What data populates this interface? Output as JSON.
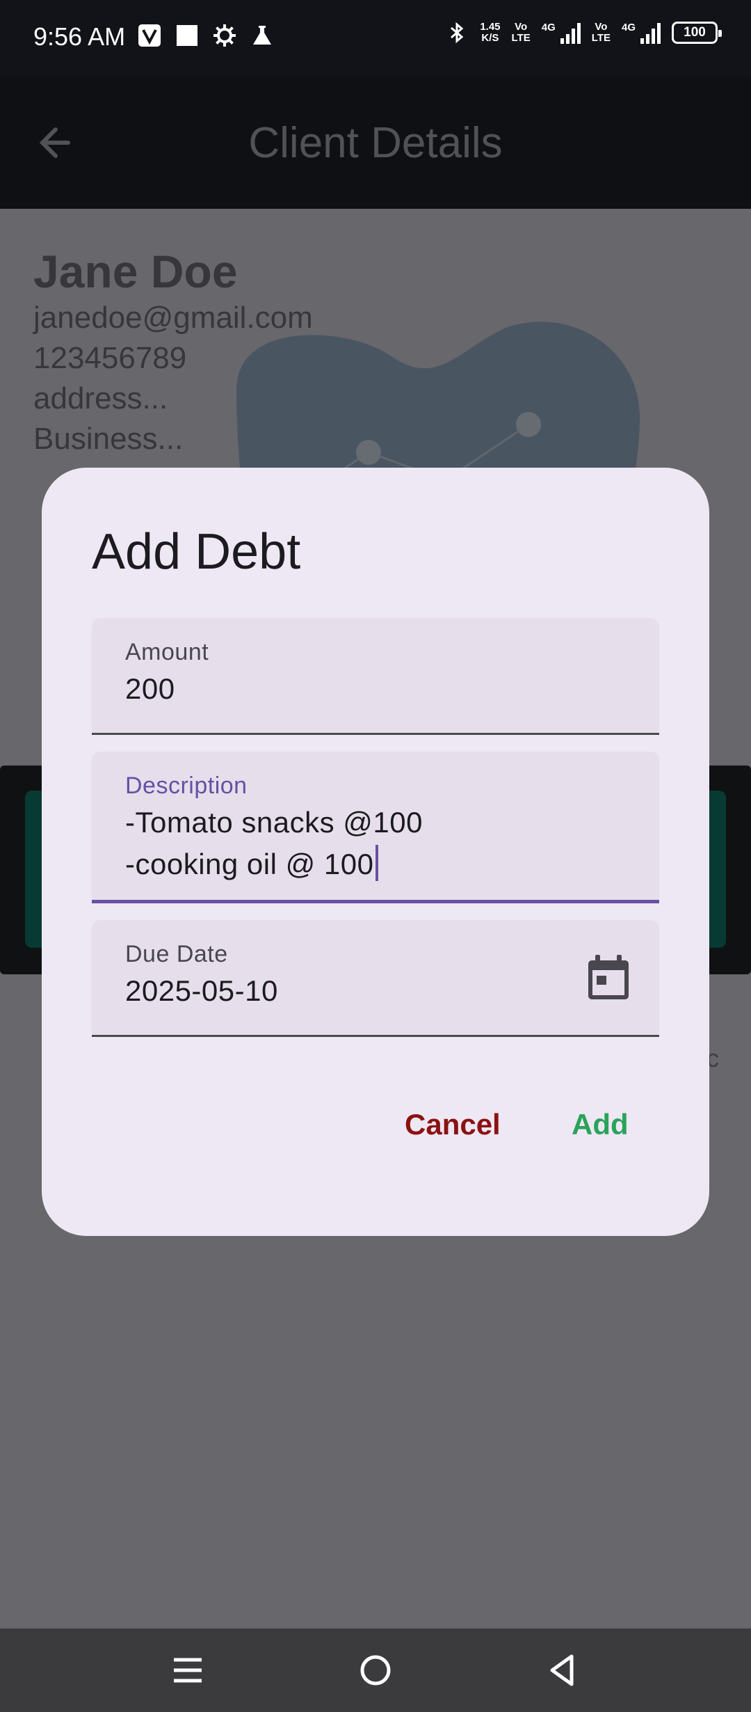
{
  "status_bar": {
    "time": "9:56 AM",
    "net_speed_value": "1.45",
    "net_speed_unit": "K/S",
    "volte_1_top": "Vo",
    "volte_1_bottom": "LTE",
    "signal_1_label": "4G",
    "volte_2_top": "Vo",
    "volte_2_bottom": "LTE",
    "signal_2_label": "4G",
    "battery": "100"
  },
  "app_bar": {
    "title": "Client Details"
  },
  "client": {
    "name": "Jane Doe",
    "email": "janedoe@gmail.com",
    "phone": "123456789",
    "address": "address...",
    "business": "Business..."
  },
  "background": {
    "partial_text": "c"
  },
  "dialog": {
    "title": "Add Debt",
    "amount": {
      "label": "Amount",
      "value": "200"
    },
    "description": {
      "label": "Description",
      "value": "-Tomato snacks @100\n-cooking oil @ 100"
    },
    "due_date": {
      "label": "Due Date",
      "value": "2025-05-10"
    },
    "cancel_label": "Cancel",
    "add_label": "Add"
  },
  "colors": {
    "accent": "#6750a4",
    "cancel": "#8b1212",
    "add": "#2aa35a",
    "dialog_bg": "#eee8f4"
  },
  "icons": [
    "back-arrow-icon",
    "calendar-icon",
    "menu-icon",
    "home-icon",
    "back-icon",
    "bluetooth-icon",
    "settings-icon",
    "flask-icon"
  ]
}
